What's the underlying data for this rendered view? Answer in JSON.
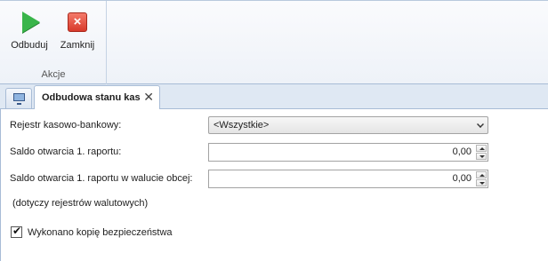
{
  "ribbon": {
    "buttons": {
      "rebuild": {
        "label": "Odbuduj",
        "icon": "play-icon"
      },
      "close": {
        "label": "Zamknij",
        "icon": "close-icon"
      }
    },
    "group_label": "Akcje"
  },
  "tabs": {
    "icon_tab": {
      "icon": "monitor-icon"
    },
    "active": {
      "title": "Odbudowa stanu kas",
      "close_glyph": "✕"
    }
  },
  "form": {
    "register": {
      "label": "Rejestr kasowo-bankowy:",
      "value": "<Wszystkie>"
    },
    "opening_balance": {
      "label": "Saldo otwarcia 1. raportu:",
      "value": "0,00"
    },
    "opening_balance_fx": {
      "label": "Saldo otwarcia 1. raportu w walucie obcej:",
      "value": "0,00"
    },
    "fx_note": "(dotyczy rejestrów walutowych)",
    "backup": {
      "label": "Wykonano kopię bezpieczeństwa",
      "checked": true,
      "check_glyph": "✔"
    }
  },
  "colors": {
    "accent": "#39b54a",
    "close_red": "#d83a2b",
    "border": "#a8bcd6"
  }
}
